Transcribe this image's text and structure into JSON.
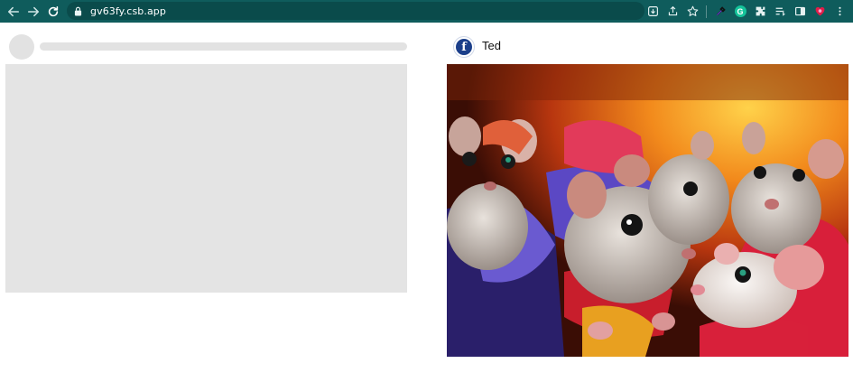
{
  "browser": {
    "url": "gv63fy.csb.app",
    "icons": [
      "back-icon",
      "forward-icon",
      "reload-icon",
      "lock-icon",
      "install-icon",
      "share-icon",
      "star-icon",
      "eyedropper-icon",
      "grammarly-icon",
      "extensions-icon",
      "reading-list-icon",
      "side-panel-icon",
      "profile-icon",
      "menu-icon"
    ],
    "grammarly_letter": "G",
    "accent": "#0f5c5c"
  },
  "skeleton_card": {
    "placeholder_color": "#e2e2e2"
  },
  "post_card": {
    "avatar_letter": "f",
    "username": "Ted",
    "image_description_colors": [
      "#c2410c",
      "#f59e0b",
      "#6d28d9",
      "#dc2626"
    ]
  }
}
